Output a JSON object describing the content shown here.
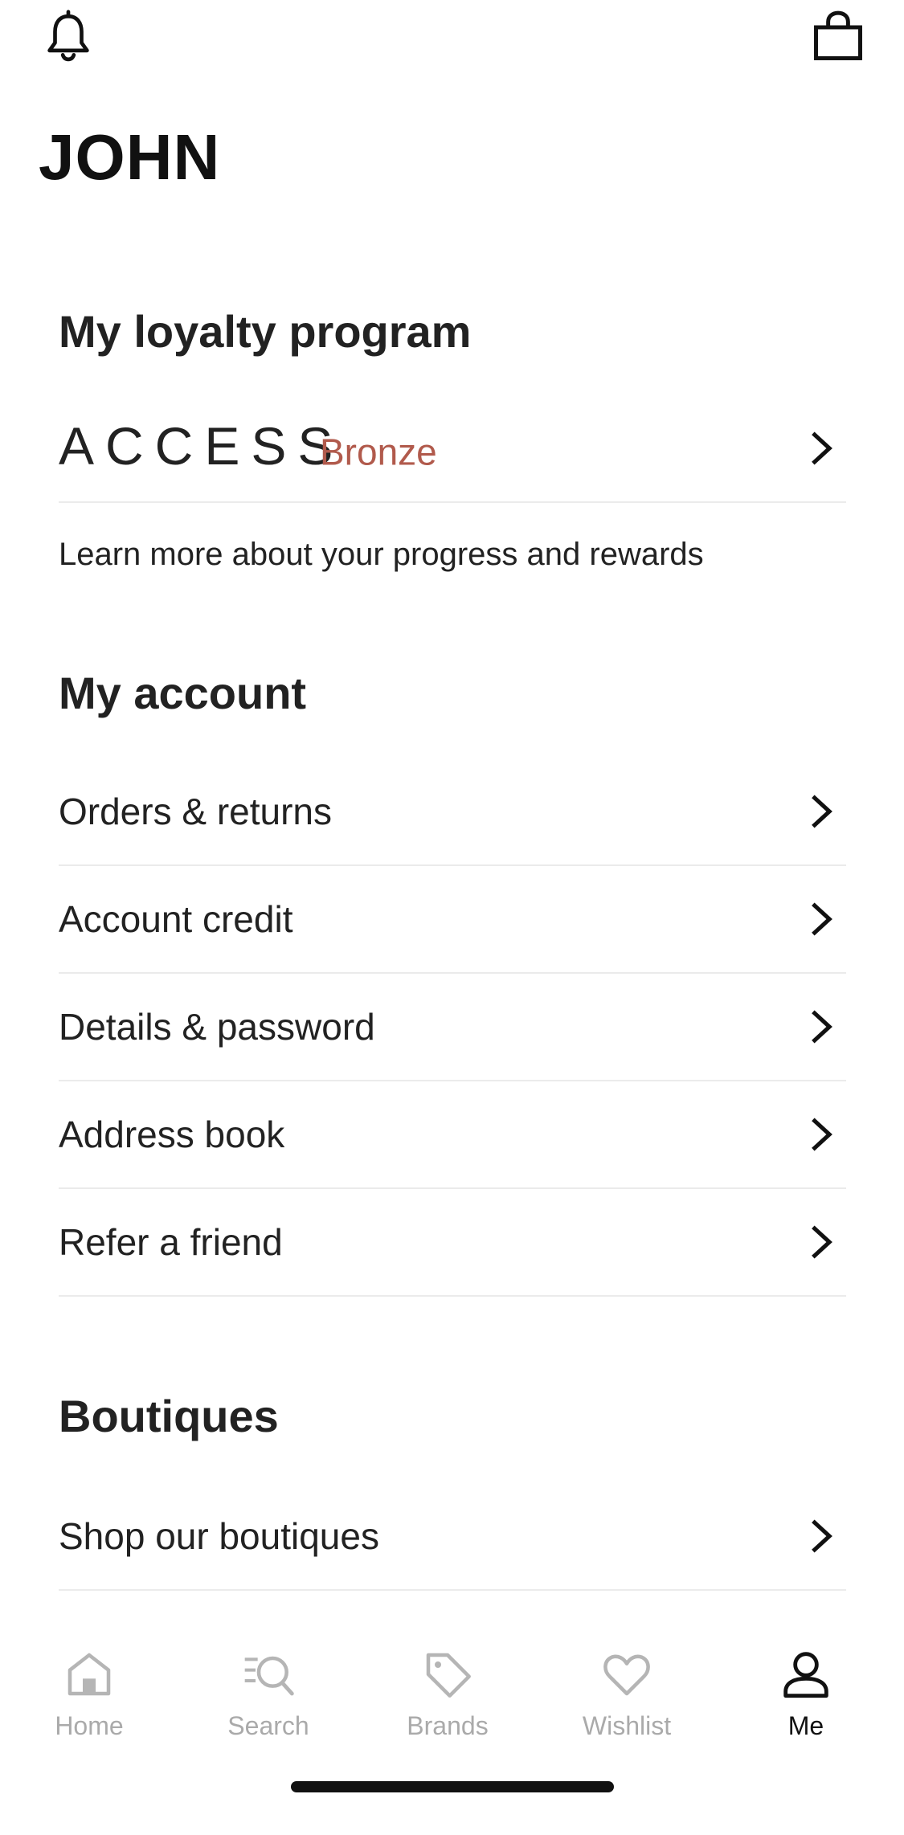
{
  "header": {
    "bell_icon": "bell-icon",
    "bag_icon": "shopping-bag-icon",
    "user_name": "JOHN"
  },
  "loyalty": {
    "title": "My loyalty program",
    "program_name": "ACCESS",
    "tier": "Bronze",
    "tier_color": "#b15a4c",
    "learn_more": "Learn more about your progress and rewards"
  },
  "account": {
    "title": "My account",
    "items": [
      {
        "label": "Orders & returns"
      },
      {
        "label": "Account credit"
      },
      {
        "label": "Details & password"
      },
      {
        "label": "Address book"
      },
      {
        "label": "Refer a friend"
      }
    ]
  },
  "boutiques": {
    "title": "Boutiques",
    "items": [
      {
        "label": "Shop our boutiques"
      }
    ]
  },
  "tabbar": {
    "tabs": [
      {
        "label": "Home",
        "icon": "home-icon",
        "active": false
      },
      {
        "label": "Search",
        "icon": "search-icon",
        "active": false
      },
      {
        "label": "Brands",
        "icon": "tag-icon",
        "active": false
      },
      {
        "label": "Wishlist",
        "icon": "heart-icon",
        "active": false
      },
      {
        "label": "Me",
        "icon": "person-icon",
        "active": true
      }
    ]
  }
}
